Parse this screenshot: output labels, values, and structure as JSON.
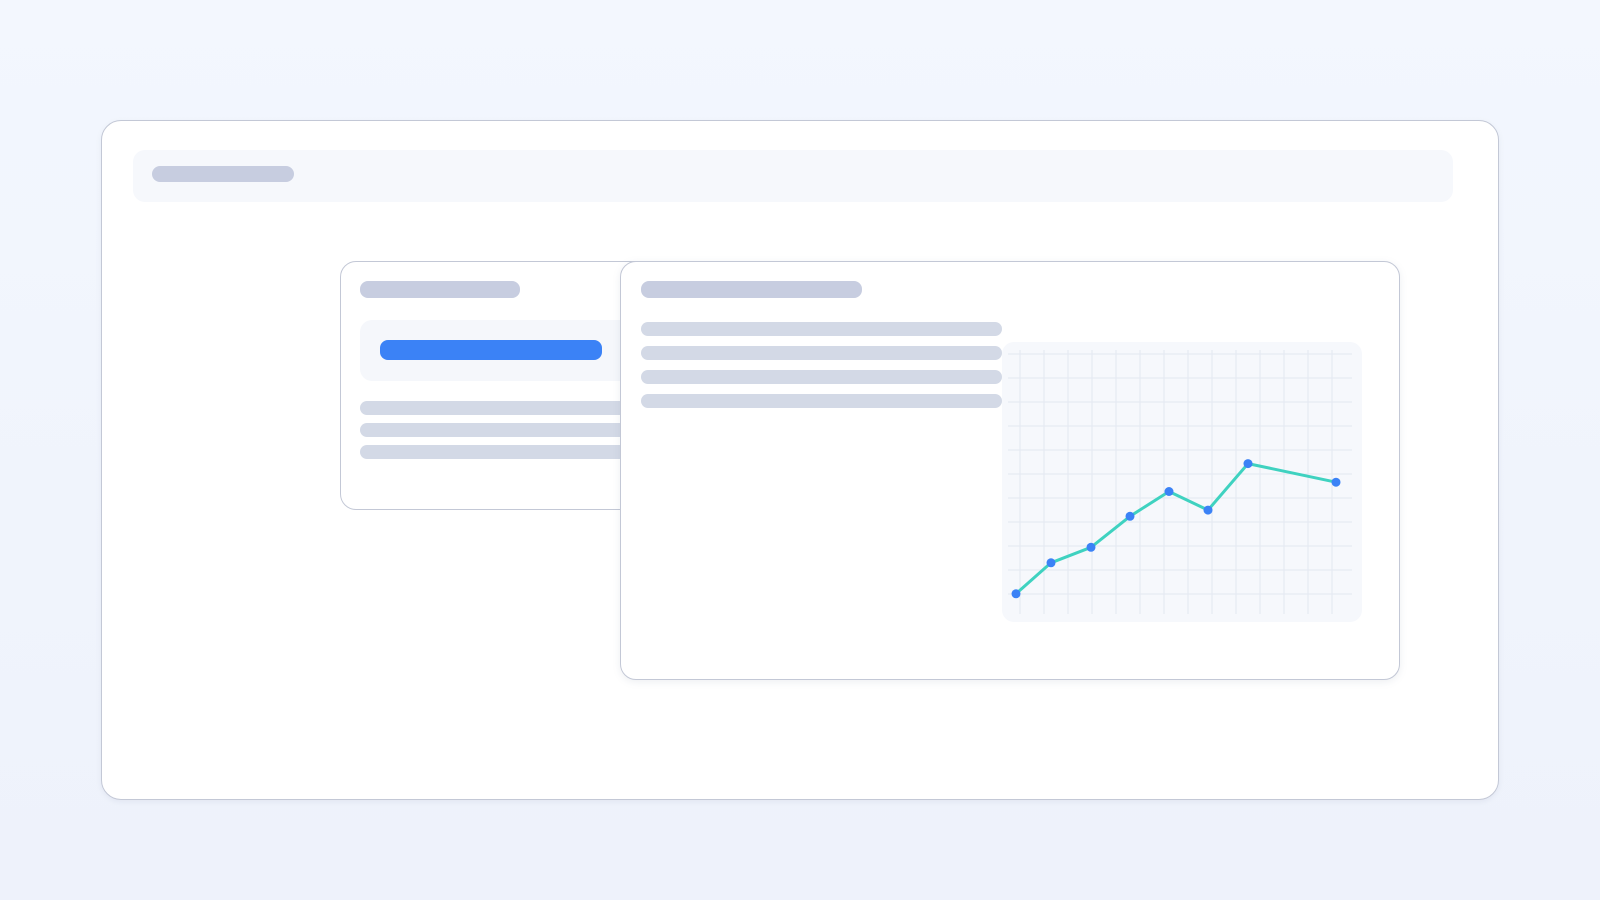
{
  "chart_data": {
    "type": "line",
    "grid": true,
    "x": [
      1,
      2,
      3,
      4,
      5,
      6,
      7,
      8
    ],
    "values": [
      2,
      12,
      17,
      27,
      35,
      29,
      44,
      38
    ],
    "ylim": [
      0,
      60
    ],
    "colors": {
      "line": "#3fd2c0",
      "point": "#3b82f6",
      "grid": "#e3e8f1"
    }
  },
  "colors": {
    "accent": "#3b82f6",
    "placeholder": "#c7cde0",
    "placeholder_light": "#d3d9e6"
  }
}
